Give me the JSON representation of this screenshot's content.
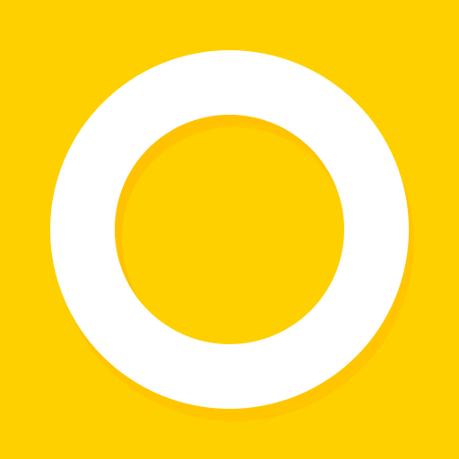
{
  "app_icon": {
    "icon_name": "ring-icon",
    "colors": {
      "background": "#FFD000",
      "ring": "#FFFFFF",
      "ring_shadow": "#FFC600",
      "inner_shadow": "#FFC200"
    }
  }
}
